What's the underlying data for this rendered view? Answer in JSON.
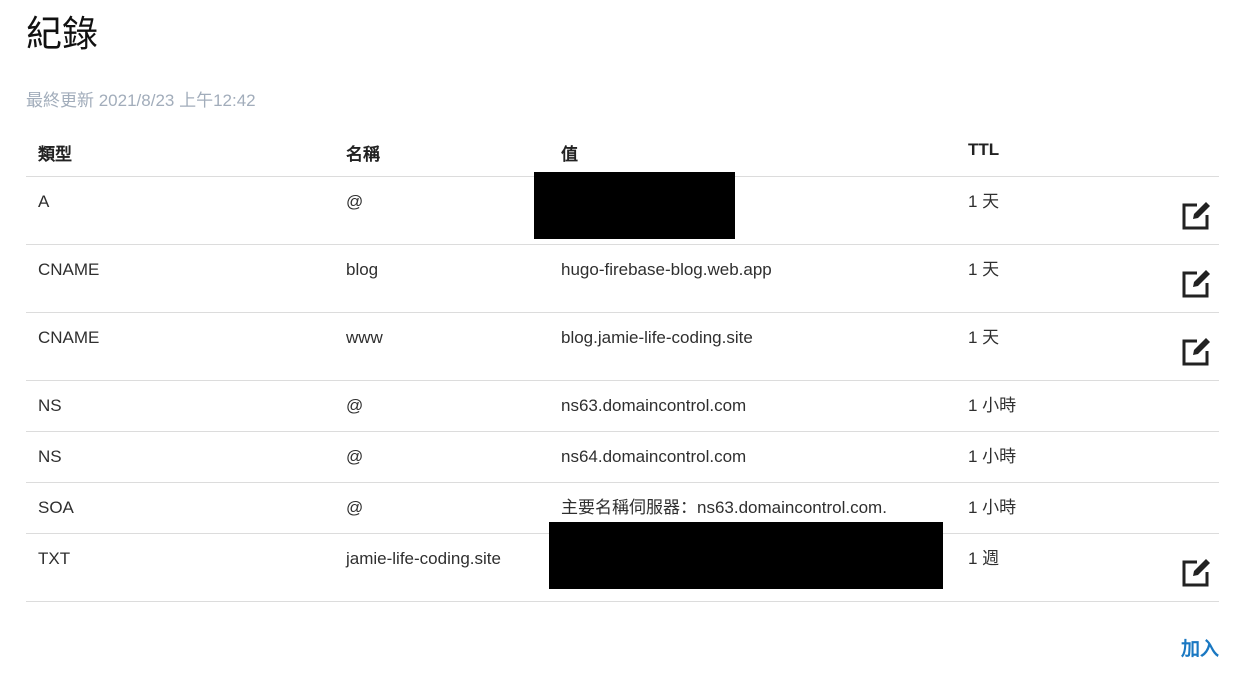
{
  "page": {
    "title": "紀錄",
    "last_updated": "最終更新 2021/8/23 上午12:42",
    "add_label": "加入"
  },
  "table": {
    "headers": [
      "類型",
      "名稱",
      "值",
      "TTL"
    ],
    "rows": [
      {
        "type": "A",
        "name": "@",
        "value": "",
        "ttl": "1 天",
        "editable": true,
        "value_redacted": true
      },
      {
        "type": "CNAME",
        "name": "blog",
        "value": "hugo-firebase-blog.web.app",
        "ttl": "1 天",
        "editable": true
      },
      {
        "type": "CNAME",
        "name": "www",
        "value": "blog.jamie-life-coding.site",
        "ttl": "1 天",
        "editable": true
      },
      {
        "type": "NS",
        "name": "@",
        "value": "ns63.domaincontrol.com",
        "ttl": "1 小時",
        "editable": false
      },
      {
        "type": "NS",
        "name": "@",
        "value": "ns64.domaincontrol.com",
        "ttl": "1 小時",
        "editable": false
      },
      {
        "type": "SOA",
        "name": "@",
        "value": "主要名稱伺服器：ns63.domaincontrol.com.",
        "ttl": "1 小時",
        "editable": false
      },
      {
        "type": "TXT",
        "name": "jamie-life-coding.site",
        "value": "",
        "ttl": "1 週",
        "editable": true,
        "value_redacted": true
      }
    ]
  },
  "icons": {
    "edit": "edit-icon"
  },
  "colors": {
    "accent": "#1a78c2",
    "muted": "#a2adbb",
    "divider": "#dcdcdc"
  }
}
